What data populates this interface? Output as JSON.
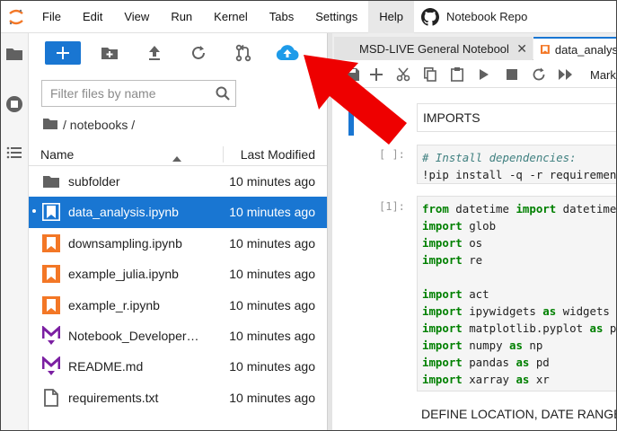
{
  "menubar": {
    "items": [
      "File",
      "Edit",
      "View",
      "Run",
      "Kernel",
      "Tabs",
      "Settings",
      "Help"
    ],
    "repo_label": "Notebook Repo"
  },
  "search": {
    "placeholder": "Filter files by name"
  },
  "breadcrumb": {
    "text": "/ notebooks /"
  },
  "file_columns": {
    "name": "Name",
    "modified": "Last Modified"
  },
  "files": [
    {
      "name": "subfolder",
      "modified": "10 minutes ago",
      "icon": "folder-icon",
      "selected": false
    },
    {
      "name": "data_analysis.ipynb",
      "modified": "10 minutes ago",
      "icon": "notebook-icon",
      "selected": true
    },
    {
      "name": "downsampling.ipynb",
      "modified": "10 minutes ago",
      "icon": "notebook-icon",
      "selected": false
    },
    {
      "name": "example_julia.ipynb",
      "modified": "10 minutes ago",
      "icon": "notebook-icon",
      "selected": false
    },
    {
      "name": "example_r.ipynb",
      "modified": "10 minutes ago",
      "icon": "notebook-icon",
      "selected": false
    },
    {
      "name": "Notebook_Developers…",
      "modified": "10 minutes ago",
      "icon": "markdown-icon",
      "selected": false
    },
    {
      "name": "README.md",
      "modified": "10 minutes ago",
      "icon": "markdown-icon",
      "selected": false
    },
    {
      "name": "requirements.txt",
      "modified": "10 minutes ago",
      "icon": "file-icon",
      "selected": false
    }
  ],
  "tabs": [
    {
      "label": "MSD-LIVE General Notebool"
    },
    {
      "label": "data_analys"
    }
  ],
  "notebook_toolbar": {
    "cell_type": "Mark"
  },
  "cells": {
    "markdown_1": "IMPORTS",
    "prompt_1": "[ ]:",
    "code_1_comment": "# Install dependencies:",
    "code_1_line": "!pip install -q -r requirements.txt",
    "prompt_2": "[1]:",
    "markdown_2": "DEFINE LOCATION, DATE RANGE, AND MODEL"
  },
  "code_2_lines": [
    {
      "kw": "from",
      "rest": " datetime ",
      "kw2": "import",
      "rest2": " datetime"
    },
    {
      "kw": "import",
      "rest": " glob"
    },
    {
      "kw": "import",
      "rest": " os"
    },
    {
      "kw": "import",
      "rest": " re"
    },
    {
      "blank": true
    },
    {
      "kw": "import",
      "rest": " act"
    },
    {
      "kw": "import",
      "rest": " ipywidgets ",
      "kw2": "as",
      "rest2": " widgets"
    },
    {
      "kw": "import",
      "rest": " matplotlib.pyplot ",
      "kw2": "as",
      "rest2": " plt"
    },
    {
      "kw": "import",
      "rest": " numpy ",
      "kw2": "as",
      "rest2": " np"
    },
    {
      "kw": "import",
      "rest": " pandas ",
      "kw2": "as",
      "rest2": " pd"
    },
    {
      "kw": "import",
      "rest": " xarray ",
      "kw2": "as",
      "rest2": " xr"
    }
  ],
  "colors": {
    "accent": "#1976d2",
    "arrow": "#ee0000",
    "notebook_orange": "#f37726",
    "markdown_purple": "#7b1fa2",
    "upload_cloud": "#1e9be9",
    "keyword_green": "#008000"
  }
}
